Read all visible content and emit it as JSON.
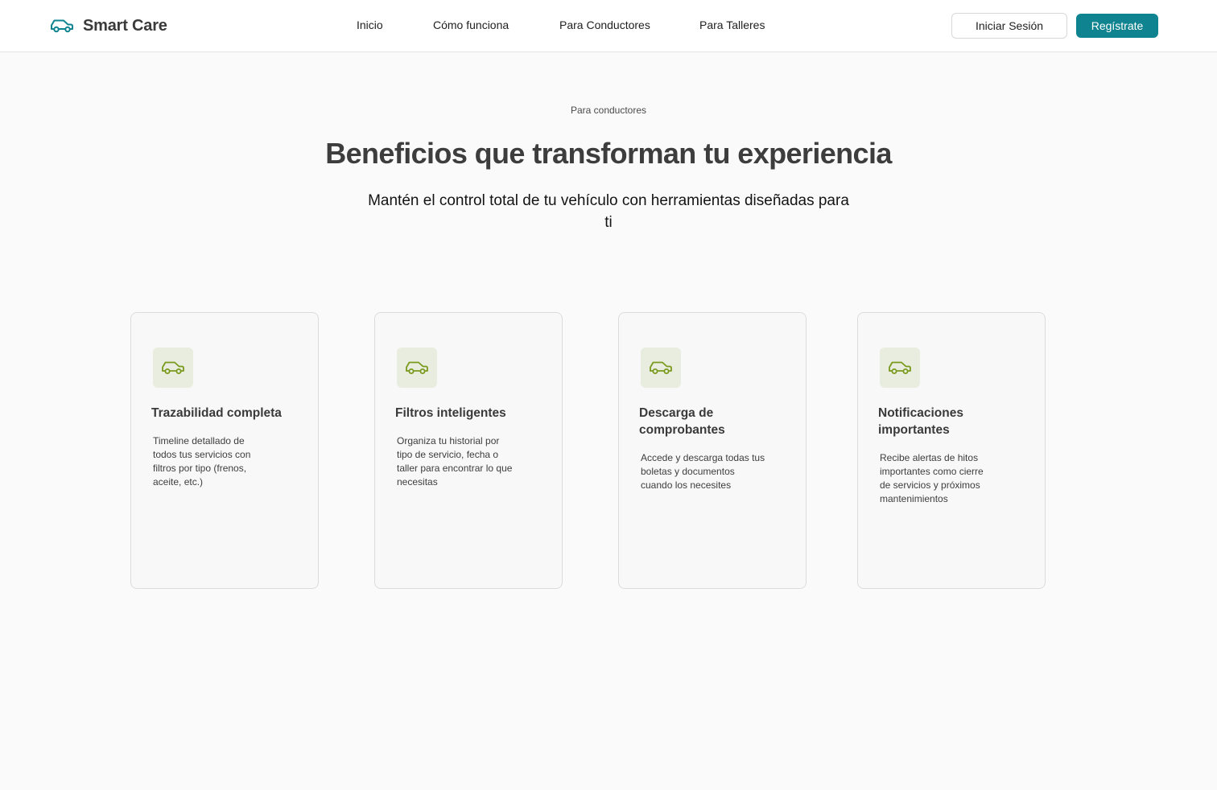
{
  "brand": {
    "name": "Smart Care",
    "icon": "car-icon",
    "color": "#0f8490"
  },
  "nav": {
    "links": [
      {
        "label": "Inicio"
      },
      {
        "label": "Cómo funciona"
      },
      {
        "label": "Para Conductores"
      },
      {
        "label": "Para Talleres"
      }
    ],
    "login_label": "Iniciar Sesión",
    "register_label": "Regístrate"
  },
  "hero": {
    "eyebrow": "Para conductores",
    "title": "Beneficios que transforman tu experiencia",
    "subtitle": "Mantén el control total de tu vehículo con herramientas diseñadas para ti"
  },
  "benefits": [
    {
      "icon": "car-icon",
      "title": "Trazabilidad completa",
      "description": "Timeline detallado de todos tus servicios con filtros por tipo (frenos, aceite, etc.)"
    },
    {
      "icon": "car-icon",
      "title": "Filtros inteligentes",
      "description": "Organiza tu historial por tipo de servicio, fecha o taller para encontrar lo que necesitas"
    },
    {
      "icon": "car-icon",
      "title": "Descarga de comprobantes",
      "description": "Accede y descarga todas tus boletas y documentos cuando los necesites"
    },
    {
      "icon": "car-icon",
      "title": "Notificaciones importantes",
      "description": "Recibe alertas de hitos importantes como cierre de servicios y próximos mantenimientos"
    }
  ],
  "colors": {
    "accent": "#0f8490",
    "icon_green": "#7a9a1e",
    "icon_bg": "#e8eddf",
    "background": "#fafafa"
  }
}
